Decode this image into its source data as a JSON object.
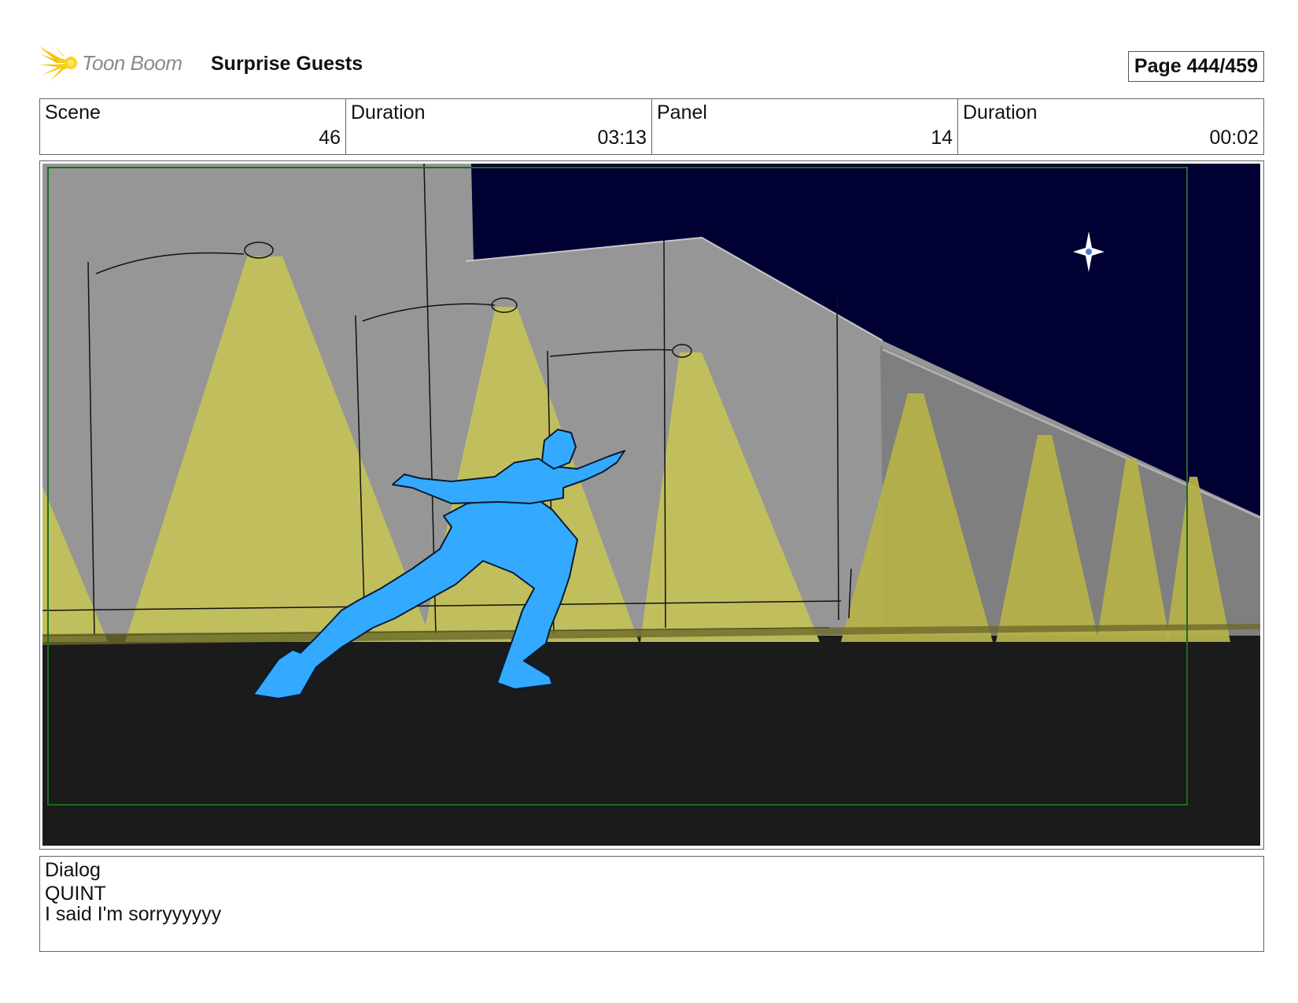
{
  "header": {
    "logo_text": "Toon Boom",
    "project_title": "Surprise Guests",
    "page_label": "Page 444/459"
  },
  "info": {
    "scene_label": "Scene",
    "scene_value": "46",
    "scene_duration_label": "Duration",
    "scene_duration_value": "03:13",
    "panel_label": "Panel",
    "panel_value": "14",
    "panel_duration_label": "Duration",
    "panel_duration_value": "00:02"
  },
  "dialog": {
    "label": "Dialog",
    "speaker": "QUINT",
    "line": "I said I'm sorryyyyyy"
  },
  "colors": {
    "sky": "#000033",
    "wall": "#969696",
    "ground": "#1b1b1b",
    "light_cone": "#c8c45a",
    "character": "#33aaff",
    "safe_frame": "#1e6b1e",
    "logo_yellow": "#f5c400"
  }
}
